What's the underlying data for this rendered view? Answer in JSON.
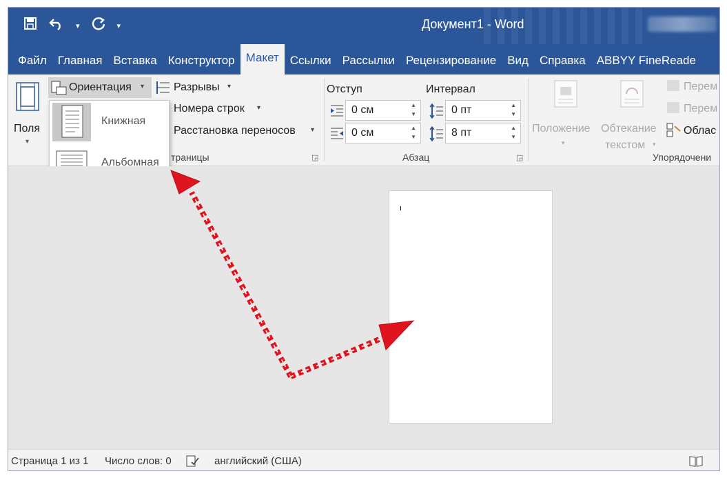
{
  "titlebar": {
    "document_title": "Документ1  -  Word",
    "qat_icons": [
      "save-icon",
      "undo-icon",
      "redo-icon",
      "customize-icon"
    ]
  },
  "tabs": [
    "Файл",
    "Главная",
    "Вставка",
    "Конструктор",
    "Макет",
    "Ссылки",
    "Рассылки",
    "Рецензирование",
    "Вид",
    "Справка",
    "ABBYY FineReade"
  ],
  "active_tab": "Макет",
  "ribbon": {
    "margins_label": "Поля",
    "orientation_label": "Ориентация",
    "breaks_label": "Разрывы",
    "line_numbers_label": "Номера строк",
    "hyphenation_label": "Расстановка переносов",
    "page_setup_group_label": "траницы",
    "indent_label": "Отступ",
    "spacing_label": "Интервал",
    "indent_left_value": "0 см",
    "indent_right_value": "0 см",
    "spacing_before_value": "0 пт",
    "spacing_after_value": "8 пт",
    "paragraph_group_label": "Абзац",
    "position_label": "Положение",
    "wrap_label_1": "Обтекание",
    "wrap_label_2": "текстом",
    "bring_forward_label": "Перем",
    "send_backward_label": "Перем",
    "selection_pane_label": "Облас",
    "arrange_group_label": "Упорядочени"
  },
  "orientation_menu": {
    "items": [
      {
        "label": "Книжная",
        "selected": true
      },
      {
        "label": "Альбомная",
        "selected": false
      }
    ]
  },
  "statusbar": {
    "page_info": "Страница 1 из 1",
    "word_count": "Число слов: 0",
    "language": "английский (США)"
  },
  "colors": {
    "accent": "#2b579a",
    "arrow": "#e0141e"
  }
}
